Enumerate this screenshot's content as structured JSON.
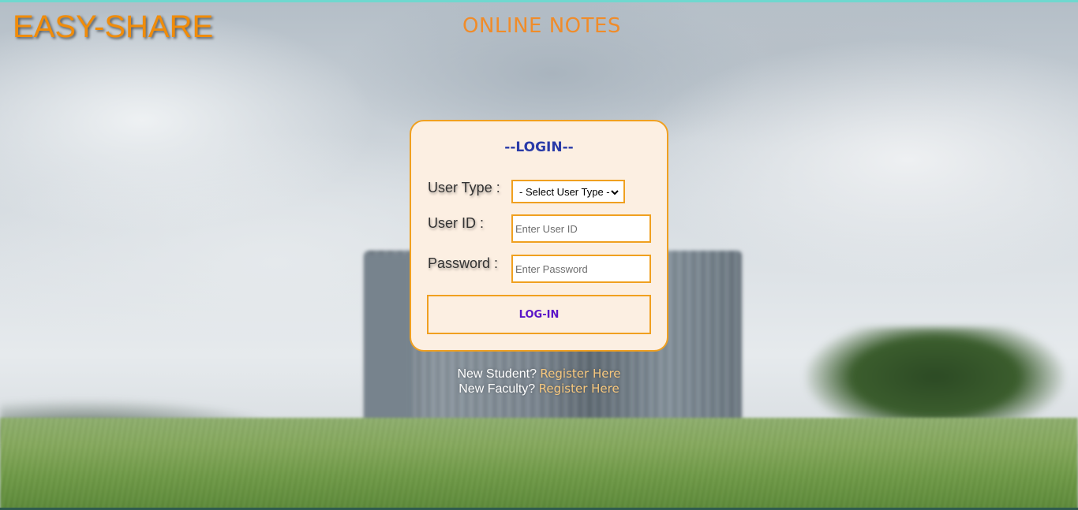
{
  "header": {
    "logo": "EASY-SHARE",
    "title": "ONLINE NOTES"
  },
  "login_card": {
    "title": "--LOGIN--",
    "user_type_label": "User Type :",
    "user_type_selected": "- Select User Type -",
    "user_id_label": "User ID :",
    "user_id_placeholder": "Enter User ID",
    "password_label": "Password :",
    "password_placeholder": "Enter Password",
    "login_button": "LOG-IN"
  },
  "register": {
    "student_prompt": "New Student?",
    "student_link": "Register Here",
    "faculty_prompt": "New Faculty?",
    "faculty_link": "Register Here"
  },
  "colors": {
    "accent": "#f0a020",
    "logo": "#f08c0a",
    "card_background": "#fcefe2",
    "card_title": "#2a3ba8",
    "button_text": "#5a14c8",
    "link": "#f7c87e"
  },
  "icons": {
    "select_arrow": "chevron-down-icon"
  }
}
